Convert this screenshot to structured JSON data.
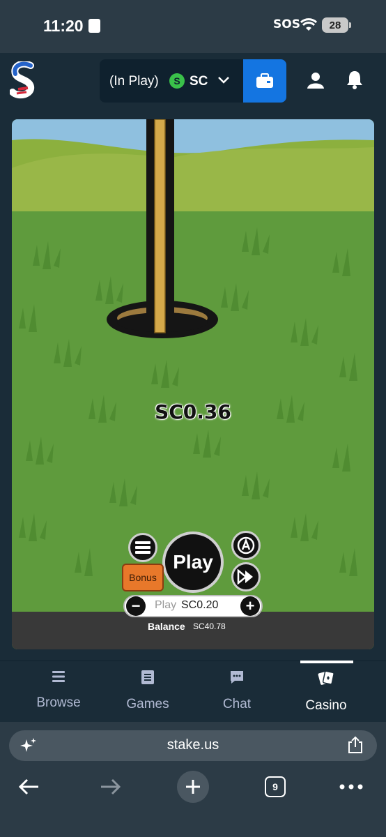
{
  "status_bar": {
    "time": "11:20",
    "sos": "SOS",
    "battery": "28"
  },
  "header": {
    "logo_icon": "stake-s-logo",
    "wallet_state": "(In Play)",
    "currency_badge": "S",
    "currency": "SC",
    "wallet_icon": "wallet-icon",
    "user_icon": "user-icon",
    "bell_icon": "bell-icon"
  },
  "game": {
    "win_amount": "SC0.36",
    "play_label": "Play",
    "bonus_label": "Bonus",
    "bet_label": "Play",
    "bet_value": "SC0.20",
    "minus": "−",
    "plus": "+",
    "balance_label": "Balance",
    "balance_value": "SC40.78"
  },
  "bottom_nav": {
    "items": [
      {
        "label": "Browse",
        "icon": "menu-icon",
        "active": false
      },
      {
        "label": "Games",
        "icon": "games-icon",
        "active": false
      },
      {
        "label": "Chat",
        "icon": "chat-icon",
        "active": false
      },
      {
        "label": "Casino",
        "icon": "cards-icon",
        "active": true
      }
    ]
  },
  "browser": {
    "url": "stake.us",
    "tab_count": "9"
  },
  "colors": {
    "accent": "#1475e1",
    "bg": "#1a2c38",
    "sc_green": "#3ac14a",
    "bonus_orange": "#e8782a"
  }
}
